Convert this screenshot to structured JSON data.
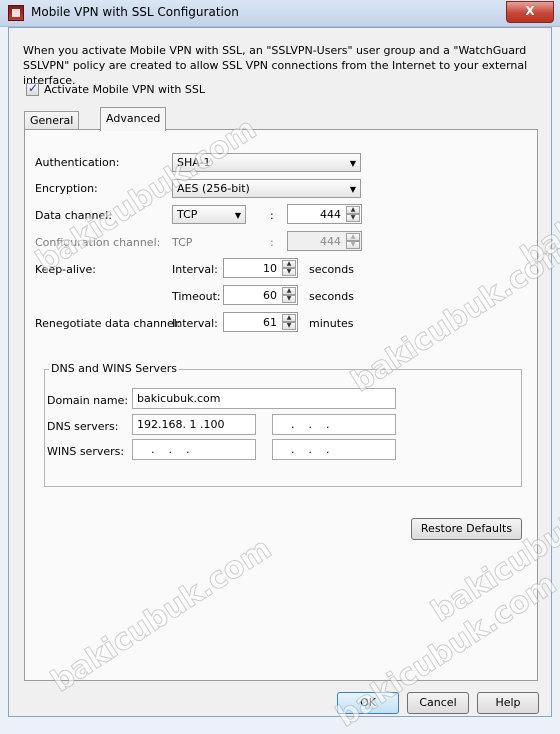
{
  "window": {
    "title": "Mobile VPN with SSL Configuration",
    "close_label": "X"
  },
  "intro_text": "When you activate Mobile VPN with SSL, an \"SSLVPN-Users\" user group and a \"WatchGuard SSLVPN\" policy are created to allow SSL VPN connections from the Internet to your external interface.",
  "activate_checkbox": {
    "label": "Activate Mobile VPN with SSL",
    "checked": true
  },
  "tabs": [
    {
      "label": "General",
      "selected": false
    },
    {
      "label": "Advanced",
      "selected": true
    }
  ],
  "advanced": {
    "authentication": {
      "label": "Authentication:",
      "value": "SHA-1"
    },
    "encryption": {
      "label": "Encryption:",
      "value": "AES (256-bit)"
    },
    "data_channel": {
      "label": "Data channel:",
      "protocol": "TCP",
      "separator": ":",
      "port": "444"
    },
    "config_channel": {
      "label": "Configuration channel:",
      "protocol": "TCP",
      "separator": ":",
      "port": "444",
      "disabled": true
    },
    "keep_alive": {
      "label": "Keep-alive:",
      "interval_label": "Interval:",
      "interval": "10",
      "interval_unit": "seconds",
      "timeout_label": "Timeout:",
      "timeout": "60",
      "timeout_unit": "seconds"
    },
    "renegotiate": {
      "label": "Renegotiate data channel:",
      "interval_label": "Interval:",
      "interval": "61",
      "unit": "minutes"
    },
    "dns_wins": {
      "title": "DNS and WINS Servers",
      "domain_label": "Domain name:",
      "domain_value": "bakicubuk.com",
      "dns_label": "DNS servers:",
      "dns1": "192.168. 1 .100",
      "dns2": "    .    .    .",
      "wins_label": "WINS servers:",
      "wins1": "    .    .    .",
      "wins2": "    .    .    ."
    },
    "restore_defaults_label": "Restore Defaults"
  },
  "buttons": {
    "ok": "OK",
    "cancel": "Cancel",
    "help": "Help"
  },
  "watermark_text": "bakicubuk.com"
}
